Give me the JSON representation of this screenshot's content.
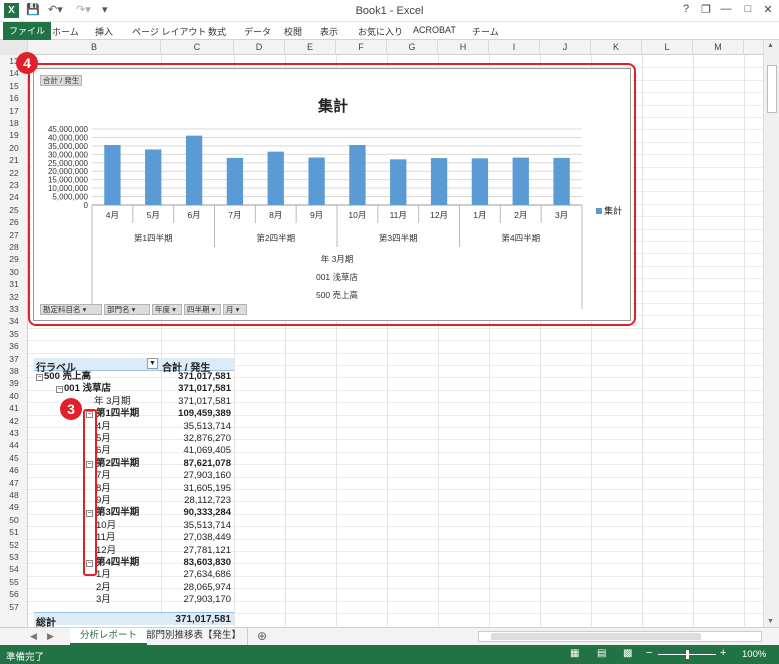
{
  "window": {
    "title": "Book1 - Excel",
    "help": "?",
    "restore": "❐",
    "minimize": "—",
    "maximize": "□",
    "close": "✕"
  },
  "ribbon": {
    "tabs": [
      "ファイル",
      "ホーム",
      "挿入",
      "ページ レイアウト",
      "数式",
      "データ",
      "校閲",
      "表示",
      "お気に入り",
      "ACROBAT",
      "チーム"
    ]
  },
  "columns": [
    "B",
    "C",
    "D",
    "E",
    "F",
    "G",
    "H",
    "I",
    "J",
    "K",
    "L",
    "M"
  ],
  "rows": [
    "13",
    "14",
    "15",
    "16",
    "17",
    "18",
    "19",
    "20",
    "21",
    "22",
    "23",
    "24",
    "25",
    "26",
    "27",
    "28",
    "29",
    "30",
    "31",
    "32",
    "33",
    "34",
    "35",
    "36",
    "37",
    "38",
    "39",
    "40",
    "41",
    "42",
    "43",
    "44",
    "45",
    "46",
    "47",
    "48",
    "49",
    "50",
    "51",
    "52",
    "53",
    "54",
    "55",
    "56",
    "57"
  ],
  "callouts": {
    "chart": "4",
    "pivot": "3"
  },
  "chart_data": {
    "type": "bar",
    "title": "集計",
    "value_field_button": "合計 / 発生",
    "categories": [
      "4月",
      "5月",
      "6月",
      "7月",
      "8月",
      "9月",
      "10月",
      "11月",
      "12月",
      "1月",
      "2月",
      "3月"
    ],
    "groups": [
      "第1四半期",
      "第2四半期",
      "第3四半期",
      "第4四半期"
    ],
    "outer_labels": [
      "年 3月期",
      "001 浅草店",
      "500 売上高"
    ],
    "series": [
      {
        "name": "集計",
        "values": [
          35513714,
          32876270,
          41069405,
          27903160,
          31605195,
          28112723,
          35513714,
          27038449,
          27781121,
          27634686,
          28065974,
          27903170
        ]
      }
    ],
    "yticks": [
      "45,000,000",
      "40,000,000",
      "35,000,000",
      "30,000,000",
      "25,000,000",
      "20,000,000",
      "15,000,000",
      "10,000,000",
      "5,000,000",
      "0"
    ],
    "ylim": [
      0,
      45000000
    ],
    "legend": "right",
    "grid": true,
    "bar_color": "#5b9bd5",
    "filter_buttons": [
      "勘定科目名",
      "部門名",
      "年度",
      "四半期",
      "月"
    ]
  },
  "pivot": {
    "header_label": "行ラベル",
    "header_value": "合計 / 発生",
    "rows": [
      {
        "label": "500 売上高",
        "value": "371,017,581",
        "bold": true,
        "toggle": "−"
      },
      {
        "label": "001 浅草店",
        "value": "371,017,581",
        "bold": true,
        "toggle": "−"
      },
      {
        "label": "年 3月期",
        "value": "371,017,581",
        "bold": false,
        "toggle": ""
      },
      {
        "label": "第1四半期",
        "value": "109,459,389",
        "bold": true,
        "toggle": "−"
      },
      {
        "label": "4月",
        "value": "35,513,714",
        "bold": false,
        "toggle": ""
      },
      {
        "label": "5月",
        "value": "32,876,270",
        "bold": false,
        "toggle": ""
      },
      {
        "label": "6月",
        "value": "41,069,405",
        "bold": false,
        "toggle": ""
      },
      {
        "label": "第2四半期",
        "value": "87,621,078",
        "bold": true,
        "toggle": "−"
      },
      {
        "label": "7月",
        "value": "27,903,160",
        "bold": false,
        "toggle": ""
      },
      {
        "label": "8月",
        "value": "31,605,195",
        "bold": false,
        "toggle": ""
      },
      {
        "label": "9月",
        "value": "28,112,723",
        "bold": false,
        "toggle": ""
      },
      {
        "label": "第3四半期",
        "value": "90,333,284",
        "bold": true,
        "toggle": "−"
      },
      {
        "label": "10月",
        "value": "35,513,714",
        "bold": false,
        "toggle": ""
      },
      {
        "label": "11月",
        "value": "27,038,449",
        "bold": false,
        "toggle": ""
      },
      {
        "label": "12月",
        "value": "27,781,121",
        "bold": false,
        "toggle": ""
      },
      {
        "label": "第4四半期",
        "value": "83,603,830",
        "bold": true,
        "toggle": "−"
      },
      {
        "label": "1月",
        "value": "27,634,686",
        "bold": false,
        "toggle": ""
      },
      {
        "label": "2月",
        "value": "28,065,974",
        "bold": false,
        "toggle": ""
      },
      {
        "label": "3月",
        "value": "27,903,170",
        "bold": false,
        "toggle": ""
      }
    ],
    "total_label": "総計",
    "total_value": "371,017,581"
  },
  "sheets": {
    "tabs": [
      "分析レポート",
      "部門別推移表【発生】"
    ],
    "add": "⊕",
    "active": 0
  },
  "status": {
    "text": "準備完了",
    "zoom": "100%",
    "zoom_minus": "−",
    "zoom_plus": "+"
  }
}
